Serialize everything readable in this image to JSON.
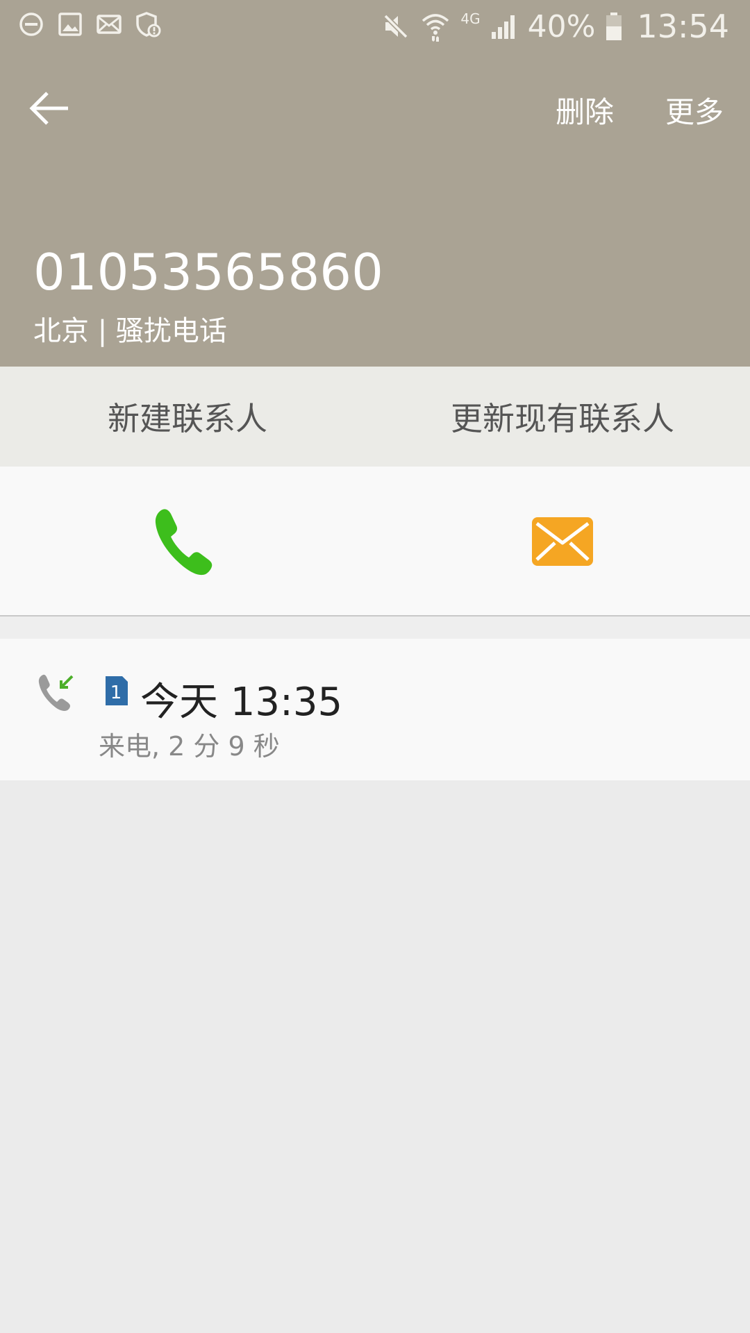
{
  "status_bar": {
    "network": "4G",
    "battery": "40%",
    "time": "13:54",
    "left_icons": [
      "dnd-icon",
      "image-icon",
      "mail-icon",
      "shield-alert-icon"
    ],
    "right_icons": [
      "mute-icon",
      "wifi-icon",
      "signal-icon",
      "battery-icon"
    ]
  },
  "app_bar": {
    "back_icon": "arrow-left-icon",
    "delete_label": "删除",
    "more_label": "更多"
  },
  "caller": {
    "number": "01053565860",
    "info": "北京 | 骚扰电话"
  },
  "contact_actions": {
    "new_contact": "新建联系人",
    "update_contact": "更新现有联系人"
  },
  "quick_actions": {
    "call_icon": "phone-icon",
    "message_icon": "envelope-icon"
  },
  "call_log": [
    {
      "type_icon": "incoming-call-icon",
      "sim": "1",
      "time": "今天 13:35",
      "detail": "来电, 2 分 9 秒"
    }
  ],
  "colors": {
    "header_bg": "#aaa394",
    "contact_bar_bg": "#ebebe7",
    "call_green": "#3dbe1c",
    "message_orange": "#f5a623",
    "sim_blue": "#2f6da8"
  }
}
